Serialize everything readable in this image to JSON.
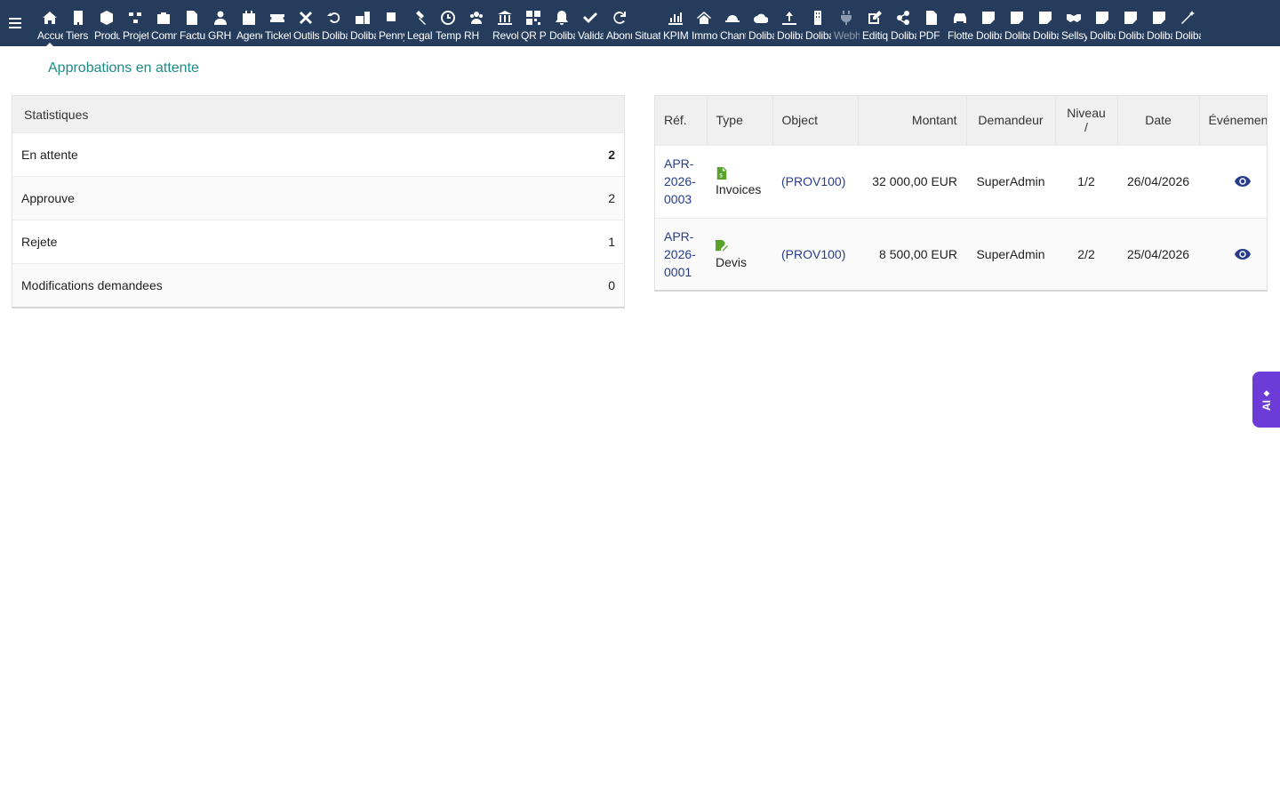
{
  "topbar": {
    "menu_items": [
      {
        "label": "Accueil",
        "icon": "home-icon",
        "active": true
      },
      {
        "label": "Tiers",
        "icon": "building-icon"
      },
      {
        "label": "Produits",
        "icon": "cube-icon"
      },
      {
        "label": "Projets",
        "icon": "project-icon"
      },
      {
        "label": "Commercial",
        "icon": "briefcase-icon"
      },
      {
        "label": "Facturation",
        "icon": "invoice-icon"
      },
      {
        "label": "GRH",
        "icon": "user-tie-icon"
      },
      {
        "label": "Agenda",
        "icon": "calendar-icon"
      },
      {
        "label": "Tickets",
        "icon": "ticket-icon"
      },
      {
        "label": "Outils",
        "icon": "tools-icon"
      },
      {
        "label": "Dolibarr",
        "icon": "undo-icon"
      },
      {
        "label": "Dolibarr",
        "icon": "briefcase-file-icon"
      },
      {
        "label": "Penny",
        "icon": "note-icon"
      },
      {
        "label": "Legal",
        "icon": "gavel-icon"
      },
      {
        "label": "Temps",
        "icon": "clock-icon"
      },
      {
        "label": "RH",
        "icon": "users-icon"
      },
      {
        "label": "Revolut",
        "icon": "bank-icon"
      },
      {
        "label": "QR Pay",
        "icon": "qrcode-icon"
      },
      {
        "label": "Dolibarr",
        "icon": "bell-icon"
      },
      {
        "label": "Validation",
        "icon": "double-check-icon"
      },
      {
        "label": "Abonnements",
        "icon": "refresh-icon"
      },
      {
        "label": "Situations",
        "icon": "blank-icon"
      },
      {
        "label": "KPIMax",
        "icon": "bar-chart-icon"
      },
      {
        "label": "Immobilier",
        "icon": "house-icon"
      },
      {
        "label": "Chantier",
        "icon": "helmet-icon"
      },
      {
        "label": "Dolibarr",
        "icon": "cloud-icon"
      },
      {
        "label": "Dolibarr",
        "icon": "upload-icon"
      },
      {
        "label": "Dolibarr",
        "icon": "tower-icon"
      },
      {
        "label": "Webhooks",
        "icon": "plug-icon",
        "dim": true
      },
      {
        "label": "Editique",
        "icon": "edit-icon"
      },
      {
        "label": "Dolibarr",
        "icon": "share-icon"
      },
      {
        "label": "PDF",
        "icon": "pdf-icon"
      },
      {
        "label": "Flotte",
        "icon": "car-icon"
      },
      {
        "label": "Dolibarr",
        "icon": "sticky-note-icon"
      },
      {
        "label": "Dolibarr",
        "icon": "sticky-note-icon"
      },
      {
        "label": "Dolibarr",
        "icon": "sticky-note-icon"
      },
      {
        "label": "Sellsy",
        "icon": "handshake-icon"
      },
      {
        "label": "Dolibarr",
        "icon": "sticky-note-icon"
      },
      {
        "label": "Dolibarr",
        "icon": "sticky-note-icon"
      },
      {
        "label": "Dolibarr",
        "icon": "sticky-note-icon"
      },
      {
        "label": "Dolibarr",
        "icon": "magic-wand-icon"
      }
    ]
  },
  "page": {
    "title": "Approbations en attente"
  },
  "stats": {
    "heading": "Statistiques",
    "rows": [
      {
        "label": "En attente",
        "value": "2",
        "bold": true
      },
      {
        "label": "Approuve",
        "value": "2"
      },
      {
        "label": "Rejete",
        "value": "1"
      },
      {
        "label": "Modifications demandees",
        "value": "0"
      }
    ]
  },
  "approvals": {
    "headers": {
      "ref": "Réf.",
      "type": "Type",
      "object": "Object",
      "amount": "Montant",
      "requester": "Demandeur",
      "level": "Niveau /",
      "date": "Date",
      "events": "Événements"
    },
    "rows": [
      {
        "ref_lines": [
          "APR-",
          "2026-",
          "0003"
        ],
        "type": "Invoices",
        "type_icon": "invoice-icon",
        "object": "(PROV100)",
        "amount": "32 000,00 EUR",
        "requester": "SuperAdmin",
        "level": "1/2",
        "date": "26/04/2026",
        "event_icon": "eye-icon"
      },
      {
        "ref_lines": [
          "APR-",
          "2026-",
          "0001"
        ],
        "type": "Devis",
        "type_icon": "quote-icon",
        "object": "(PROV100)",
        "amount": "8 500,00 EUR",
        "requester": "SuperAdmin",
        "level": "2/2",
        "date": "25/04/2026",
        "event_icon": "eye-icon"
      }
    ]
  },
  "ai_tab": {
    "label": "AI",
    "icon": "sparkle-icon"
  },
  "colors": {
    "topbar_bg": "#263c5c",
    "title": "#1f8a85",
    "link": "#263c8a",
    "type_icon": "#5aa12c",
    "ai_tab": "#6d3bd8"
  }
}
